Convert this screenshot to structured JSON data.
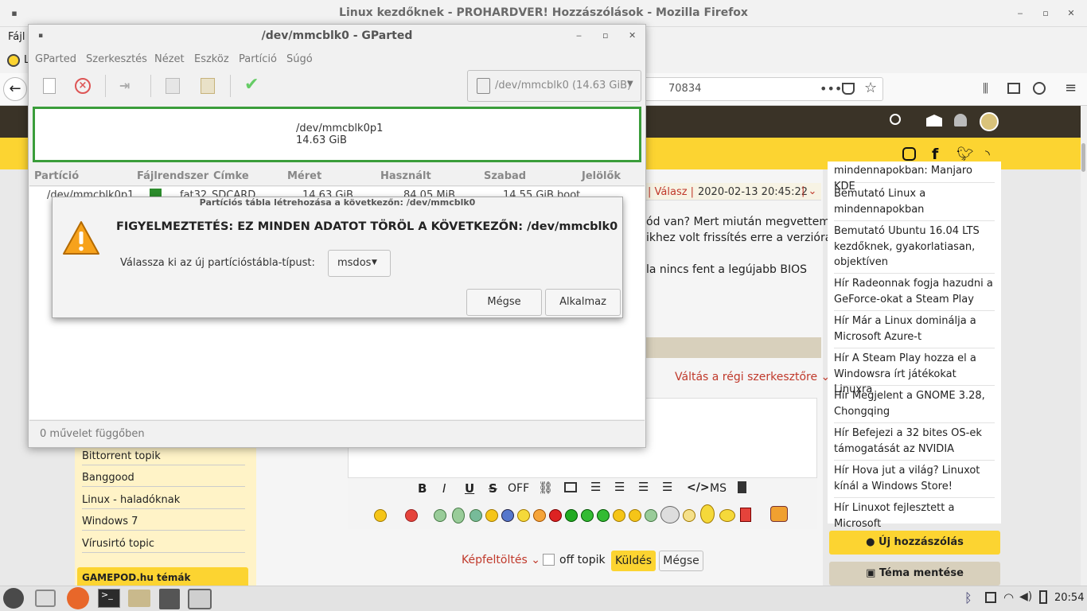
{
  "firefox": {
    "title": "Linux kezdőknek - PROHARDVER! Hozzászólások - Mozilla Firefox",
    "menu_file": "Fájl",
    "tab_letter": "L",
    "url_fragment": "70834"
  },
  "site": {
    "post_actions": {
      "reply": "Válasz",
      "datetime": "2020-02-13 20:45:22"
    },
    "post_text": [
      "ód van? Mert miután megvettem",
      "ikhez volt frissítés erre a verzióra:",
      "la nincs fent a legújabb BIOS"
    ],
    "editor_switch": "Váltás a régi szerkesztőre",
    "toolbar_labels": {
      "bold": "B",
      "italic": "I",
      "underline": "U",
      "strike": "S",
      "off": "OFF",
      "ms": "MS"
    },
    "bottom": {
      "upload": "Képfeltöltés",
      "off_topic": "off topik",
      "send": "Küldés",
      "cancel": "Mégse"
    },
    "left_links": [
      "Bittorrent topik",
      "Banggood",
      "Linux - haladóknak",
      "Windows 7",
      "Vírusirtó topic"
    ],
    "gamepod": "GAMEPOD.hu témák",
    "right_items": [
      "mindennapokban: Manjaro KDE",
      "Bemutató Linux a mindennapokban",
      "Bemutató Ubuntu 16.04 LTS kezdőknek, gyakorlatiasan, objektíven",
      "Hír Radeonnak fogja hazudni a GeForce-okat a Steam Play",
      "Hír Már a Linux dominálja a Microsoft Azure-t",
      "Hír A Steam Play hozza el a Windowsra írt játékokat Linuxra",
      "Hír Megjelent a GNOME 3.28, Chongqing",
      "Hír Befejezi a 32 bites OS-ek támogatását az NVIDIA",
      "Hír Hova jut a világ? Linuxot kínál a Windows Store!",
      "Hír Linuxot fejlesztett a Microsoft"
    ],
    "new_post": "Új hozzászólás",
    "save_topic": "Téma mentése"
  },
  "gparted": {
    "title": "/dev/mmcblk0 - GParted",
    "menu": [
      "GParted",
      "Szerkesztés",
      "Nézet",
      "Eszköz",
      "Partíció",
      "Súgó"
    ],
    "device_select": "/dev/mmcblk0 (14.63 GiB)",
    "graph_name": "/dev/mmcblk0p1",
    "graph_size": "14.63 GiB",
    "columns": [
      "Partíció",
      "Fájlrendszer",
      "Címke",
      "Méret",
      "Használt",
      "Szabad",
      "Jelölők"
    ],
    "row": {
      "partition": "/dev/mmcblk0p1",
      "fs": "fat32",
      "label": "SDCARD",
      "size": "14.63 GiB",
      "used": "84.05 MiB",
      "free": "14.55 GiB",
      "flags": "boot"
    },
    "status": "0 művelet függőben"
  },
  "dialog": {
    "title": "Partíciós tábla létrehozása a következőn: /dev/mmcblk0",
    "warning": "FIGYELMEZTETÉS: EZ MINDEN ADATOT TÖRÖL A KÖVETKEZŐN: /dev/mmcblk0",
    "prompt": "Válassza ki az új partícióstábla-típust:",
    "table_type": "msdos",
    "cancel": "Mégse",
    "apply": "Alkalmaz"
  },
  "taskbar": {
    "clock": "20:54"
  },
  "colors": {
    "site_yellow": "#fcd431",
    "site_dark": "#3a3327",
    "gparted_green": "#3a9d3a",
    "link_red": "#c0392b"
  }
}
